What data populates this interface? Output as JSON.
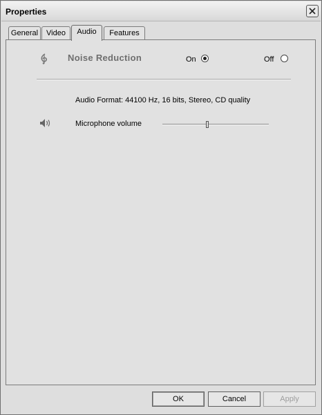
{
  "window": {
    "title": "Properties"
  },
  "tabs": [
    {
      "label": "General"
    },
    {
      "label": "Video"
    },
    {
      "label": "Audio"
    },
    {
      "label": "Features"
    }
  ],
  "active_tab": "Audio",
  "noise_reduction": {
    "label": "Noise Reduction",
    "icon": "clef-icon",
    "on_label": "On",
    "off_label": "Off",
    "selected": "On"
  },
  "audio_format": "Audio Format: 44100 Hz, 16 bits, Stereo, CD quality",
  "microphone": {
    "label": "Microphone volume",
    "icon": "speaker-icon",
    "volume_fraction": 0.42
  },
  "buttons": {
    "ok": "OK",
    "cancel": "Cancel",
    "apply": "Apply"
  }
}
